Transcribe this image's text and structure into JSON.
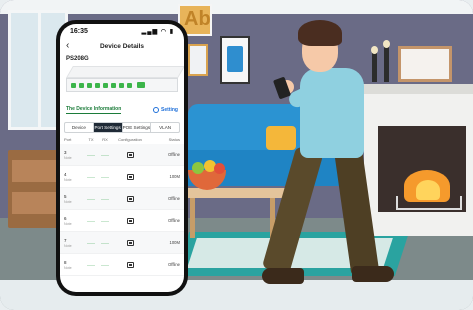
{
  "status_bar": {
    "time": "16:35",
    "icons": "▂▄▆ ◠ ▮"
  },
  "nav": {
    "back_icon": "‹",
    "title": "Device Details"
  },
  "device": {
    "name": "PS208G"
  },
  "switch_ports": {
    "active": [
      1,
      1,
      1,
      1,
      1,
      1,
      1,
      1
    ],
    "uplink": true
  },
  "info_link": "The Device Information",
  "setting_label": "Setting",
  "tabs": [
    {
      "label": "Device",
      "active": false
    },
    {
      "label": "Port Settings",
      "active": true
    },
    {
      "label": "POE Settings",
      "active": false
    },
    {
      "label": "VLAN",
      "active": false
    }
  ],
  "table": {
    "headers": {
      "port": "Port",
      "tx": "TX",
      "rx": "RX",
      "configuration": "Configuration",
      "status": "Status"
    },
    "rows": [
      {
        "port": "3",
        "note": "Note",
        "tx": "——",
        "rx": "——",
        "status": "Offline"
      },
      {
        "port": "4",
        "note": "Note",
        "tx": "——",
        "rx": "——",
        "status": "100M"
      },
      {
        "port": "5",
        "note": "Note",
        "tx": "——",
        "rx": "——",
        "status": "Offline"
      },
      {
        "port": "6",
        "note": "Note",
        "tx": "——",
        "rx": "——",
        "status": "Offline"
      },
      {
        "port": "7",
        "note": "Note",
        "tx": "——",
        "rx": "——",
        "status": "100M"
      },
      {
        "port": "8",
        "note": "Note",
        "tx": "——",
        "rx": "——",
        "status": "Offline"
      }
    ]
  },
  "scene": {
    "art_letters": "Ab"
  },
  "colors": {
    "accent_green": "#1c7c3a",
    "link_blue": "#1e6fd9",
    "active_tab": "#1f2a36"
  }
}
